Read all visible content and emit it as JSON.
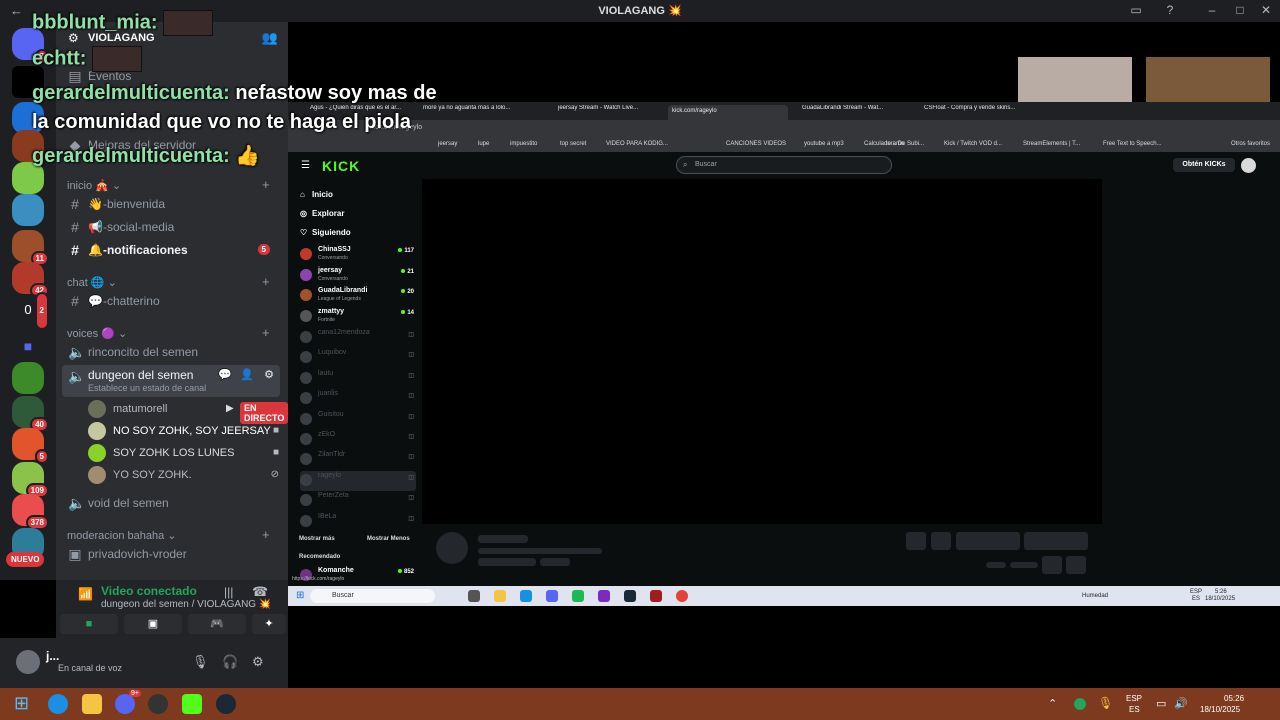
{
  "window": {
    "title": "VIOLAGANG 💥"
  },
  "rail": {
    "badges": [
      "7",
      "11",
      "42",
      "0",
      "2",
      "40",
      "5",
      "109",
      "378"
    ],
    "nuevo_label": "NUEVO"
  },
  "server": {
    "name": "VIOLAGANG",
    "events_label": "Eventos",
    "boosts_label": "Mejoras del servidor"
  },
  "categories": {
    "inicio": "inicio 🎪",
    "chat": "chat 🌐",
    "voices": "voices 🟣",
    "moderacion": "moderacion bahaha"
  },
  "channels": {
    "bienvenida": "👋-bienvenida",
    "social": "📢-social-media",
    "notificaciones": "🔔-notificaciones",
    "notificaciones_badge": "5",
    "chatterino": "💬-chatterino",
    "rinconcito": "rinconcito del semen",
    "dungeon": "dungeon del semen",
    "dungeon_status": "Establece un estado de canal",
    "void": "void del semen",
    "privadovich": "privadovich-vroder"
  },
  "voice_users": [
    {
      "name": "matumorell",
      "live": "EN DIRECTO"
    },
    {
      "name": "NO SOY ZOHK, SOY JEERSAY"
    },
    {
      "name": "SOY ZOHK LOS LUNES"
    },
    {
      "name": "YO SOY ZOHK."
    }
  ],
  "voice_panel": {
    "status": "Video conectado",
    "channel": "dungeon del semen / VIOLAGANG 💥"
  },
  "user_panel": {
    "name": "j...",
    "status": "En canal de voz"
  },
  "chat": [
    {
      "user": "bbblunt_mia:",
      "text": ""
    },
    {
      "user": "echtt:",
      "text": ""
    },
    {
      "user": "gerardelmulticuenta:",
      "text": " nefastow soy mas de"
    },
    {
      "user": "",
      "text": "la comunidad que vo no te haga el piola"
    },
    {
      "user": "gerardelmulticuenta:",
      "text": " 👍"
    }
  ],
  "browser": {
    "tabs": [
      "Agus - ¿Quién dirás que es el ar...",
      "more ya no aguanta más a lolo...",
      "jeersay Stream - Watch Live...",
      "kick.com/rageylo",
      "GuadaLibrandi Stream - Wat...",
      "CSFloat - Compra y vende skins..."
    ],
    "url": "kick.com/rageylo",
    "bookmarks": [
      "jeersay",
      "lupe",
      "impuestito",
      "top secret",
      "VIDEO PARA KODIG...",
      "CANCIONES VIDEOS",
      "youtube a mp3",
      "te amo",
      "Calculadora De Subi...",
      "Kick / Twitch VOD d...",
      "StreamElements | T...",
      "Free Text to Speech...",
      "Otros favoritos"
    ]
  },
  "kick": {
    "search_placeholder": "Buscar",
    "get_kicks": "Obtén KICKs",
    "nav": [
      "Inicio",
      "Explorar",
      "Siguiendo"
    ],
    "live_channels": [
      {
        "name": "ChinaSSJ",
        "game": "Conversando",
        "viewers": "117"
      },
      {
        "name": "jeersay",
        "game": "Conversando",
        "viewers": "21"
      },
      {
        "name": "GuadaLibrandi",
        "game": "League of Legends",
        "viewers": "20"
      },
      {
        "name": "zmattyy",
        "game": "Fortnite",
        "viewers": "14"
      }
    ],
    "offline_channels": [
      "cana12mendoza",
      "Luquibov",
      "lautu",
      "juanlis",
      "Guisitou",
      "zEkO",
      "ZilanTldr",
      "rageylo",
      "PeterZeta",
      "IBeLa"
    ],
    "show_more": "Mostrar más",
    "show_less": "Mostrar Menos",
    "recommended_label": "Recomendado",
    "recommended": {
      "name": "Komanche",
      "viewers": "852"
    },
    "status_url": "https://kick.com/rageylo"
  },
  "inner_taskbar": {
    "search": "Buscar",
    "weather": "Humedad",
    "lang": "ESP",
    "lang2": "ES",
    "time": "5:26",
    "date": "18/10/2025"
  },
  "taskbar": {
    "lang": "ESP",
    "lang2": "ES",
    "time": "05:26",
    "date": "18/10/2025",
    "discord_badge": "9+"
  },
  "colors": {
    "kick_green": "#53fc18",
    "discord_red": "#da373c",
    "connected_green": "#23a55a"
  }
}
